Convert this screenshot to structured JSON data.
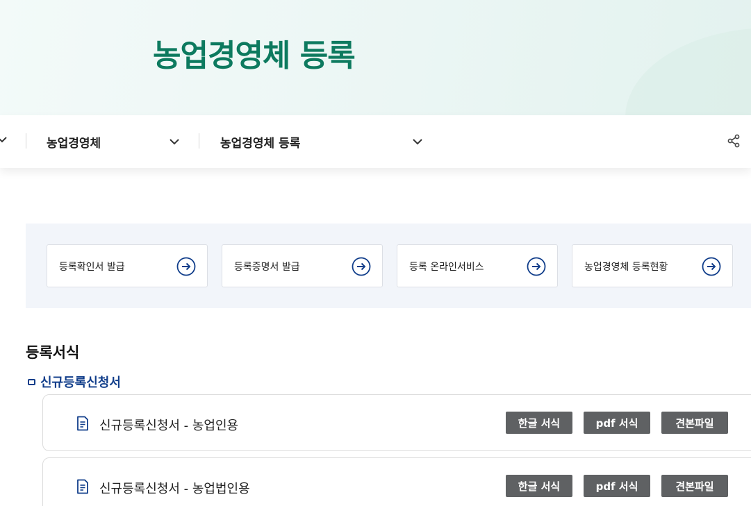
{
  "hero": {
    "title": "농업경영체 등록"
  },
  "navbar": {
    "items": [
      {
        "label": "농업경영체"
      },
      {
        "label": "농업경영체 등록"
      }
    ],
    "share_icon": "share-icon"
  },
  "quick_links": [
    {
      "label": "등록확인서 발급"
    },
    {
      "label": "등록증명서 발급"
    },
    {
      "label": "등록 온라인서비스"
    },
    {
      "label": "농업경영체 등록현황"
    }
  ],
  "section": {
    "title": "등록서식",
    "subtitle": "신규등록신청서",
    "forms": [
      {
        "name": "신규등록신청서 - 농업인용",
        "buttons": [
          "한글 서식",
          "pdf 서식",
          "견본파일"
        ]
      },
      {
        "name": "신규등록신청서 - 농업법인용",
        "buttons": [
          "한글 서식",
          "pdf 서식",
          "견본파일"
        ]
      }
    ]
  },
  "colors": {
    "hero_title": "#0d7a5f",
    "accent_navy": "#103d8a",
    "button_bg": "#5f6163",
    "panel_bg": "#f2f5fa"
  }
}
